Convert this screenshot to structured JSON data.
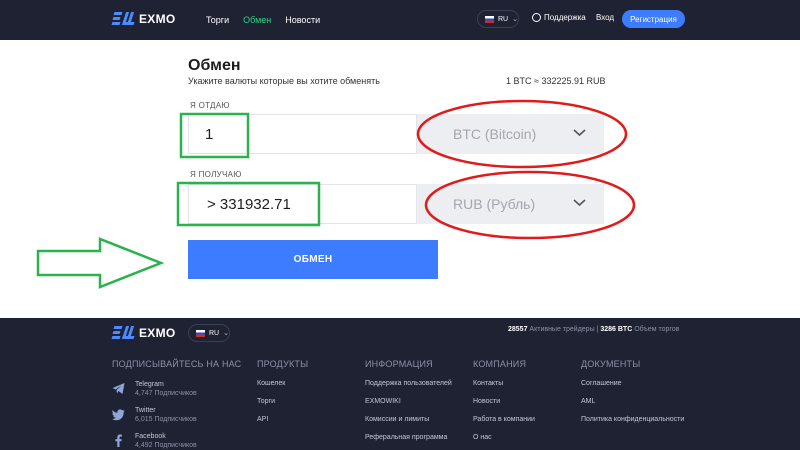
{
  "header": {
    "logo": "EXMO",
    "nav": [
      "Торги",
      "Обмен",
      "Новости"
    ],
    "lang": "RU",
    "support": "Поддержка",
    "login": "Вход",
    "register": "Регистрация"
  },
  "exchange": {
    "title": "Обмен",
    "subtitle": "Укажите валюты которые вы хотите обменять",
    "rate": "1 BTC ≈ 332225.91 RUB",
    "give_label": "Я ОТДАЮ",
    "give_value": "1",
    "give_currency": "BTC (Bitcoin)",
    "get_label": "Я ПОЛУЧАЮ",
    "get_value": "> 331932.71",
    "get_currency": "RUB (Рубль)",
    "submit": "ОБМЕН"
  },
  "footer": {
    "logo": "EXMO",
    "lang": "RU",
    "traders_count": "28557",
    "traders_label": "Активные трейдеры",
    "volume_count": "3286 BTC",
    "volume_label": "Объем торгов",
    "subscribe_title": "ПОДПИСЫВАЙТЕСЬ НА НАС",
    "social": [
      {
        "name": "Telegram",
        "count": "4,747 Подписчиков"
      },
      {
        "name": "Twitter",
        "count": "6,015 Подписчиков"
      },
      {
        "name": "Facebook",
        "count": "4,492 Подписчиков"
      }
    ],
    "columns": [
      {
        "title": "ПРОДУКТЫ",
        "links": [
          "Кошелек",
          "Торги",
          "API"
        ]
      },
      {
        "title": "ИНФОРМАЦИЯ",
        "links": [
          "Поддержка пользователей",
          "EXMOWIKI",
          "Комиссии и лимиты",
          "Реферальная программа"
        ]
      },
      {
        "title": "КОМПАНИЯ",
        "links": [
          "Контакты",
          "Новости",
          "Работа в компании",
          "О нас"
        ]
      },
      {
        "title": "ДОКУМЕНТЫ",
        "links": [
          "Соглашение",
          "AML",
          "Политика конфиденциальности"
        ]
      }
    ]
  },
  "colors": {
    "header_bg": "#1f2233",
    "accent": "#3d7bff",
    "active_nav": "#2fd38a",
    "annotation_green": "#2bb24c",
    "annotation_red": "#e01b1b"
  }
}
